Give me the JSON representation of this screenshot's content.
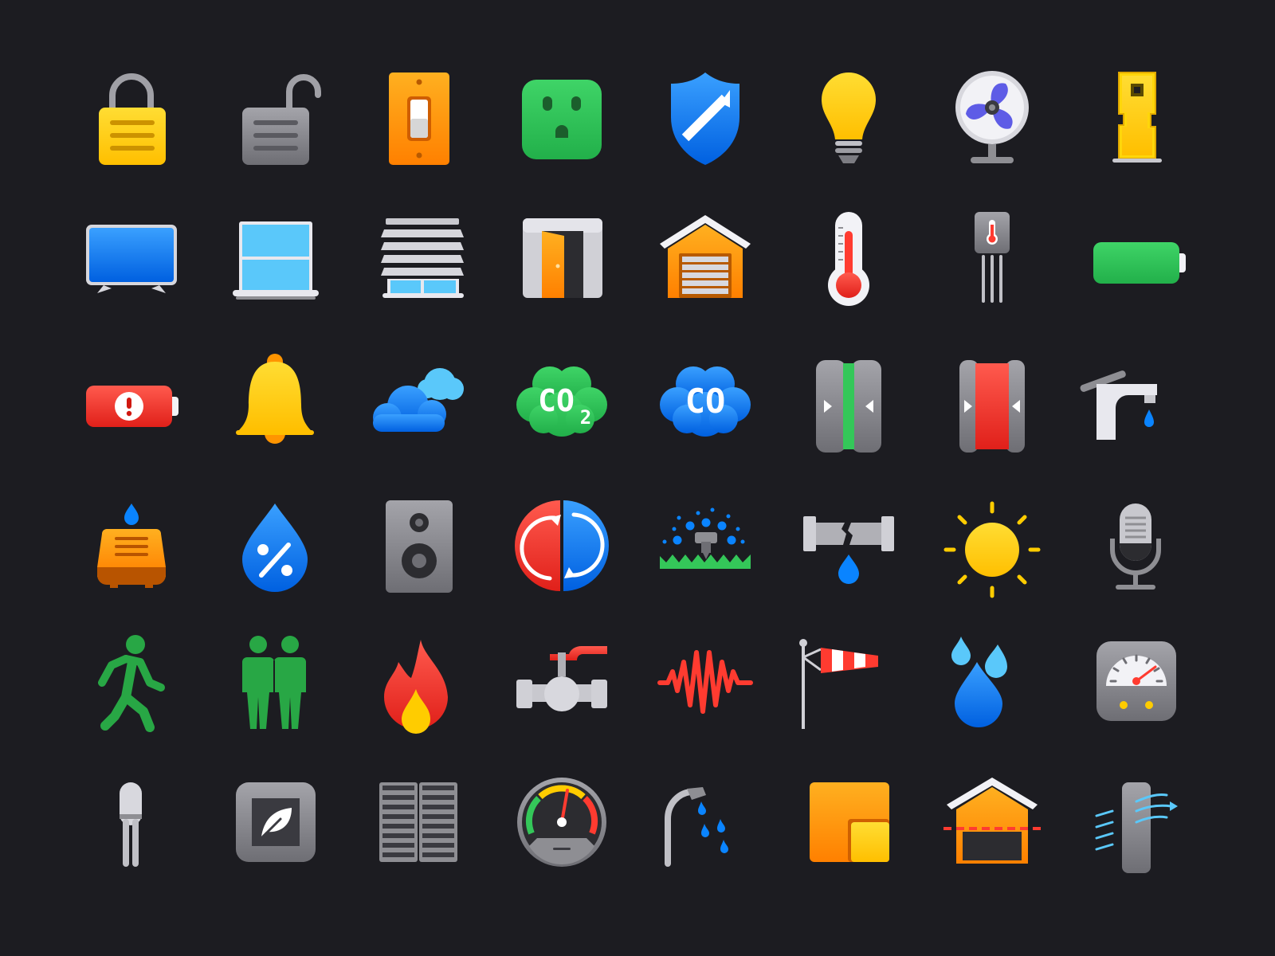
{
  "icon_set": {
    "rows": [
      [
        "lock-closed-icon",
        "lock-open-icon",
        "light-switch-icon",
        "power-outlet-icon",
        "security-shield-icon",
        "light-bulb-icon",
        "fan-icon",
        "air-purifier-icon"
      ],
      [
        "television-icon",
        "window-icon",
        "window-blinds-icon",
        "door-icon",
        "garage-door-icon",
        "thermometer-icon",
        "temperature-sensor-icon",
        "battery-full-icon"
      ],
      [
        "battery-low-icon",
        "bell-icon",
        "cloud-icon",
        "co2-sensor-icon",
        "co-sensor-icon",
        "contact-sensor-closed-icon",
        "contact-sensor-open-icon",
        "faucet-icon"
      ],
      [
        "humidifier-icon",
        "humidity-icon",
        "speaker-icon",
        "heat-cool-mode-icon",
        "sprinkler-icon",
        "leak-pipe-icon",
        "sun-icon",
        "microphone-icon"
      ],
      [
        "motion-walking-icon",
        "occupancy-people-icon",
        "flame-icon",
        "water-valve-icon",
        "vibration-icon",
        "windsock-icon",
        "water-drops-icon",
        "meter-gauge-icon"
      ],
      [
        "probe-sensor-icon",
        "eco-mode-icon",
        "radiator-icon",
        "speedometer-icon",
        "shower-icon",
        "floor-plan-icon",
        "garage-open-icon",
        "air-flow-icon"
      ]
    ]
  },
  "sensor_labels": {
    "co2_main": "CO",
    "co2_sub": "2",
    "co": "CO"
  },
  "colors": {
    "background": "#1c1c21",
    "yellow": "#ffcc00",
    "orange": "#ff9500",
    "green": "#34c759",
    "blue": "#0a84ff",
    "red": "#ff3b30",
    "gray": "#8e8e93"
  }
}
